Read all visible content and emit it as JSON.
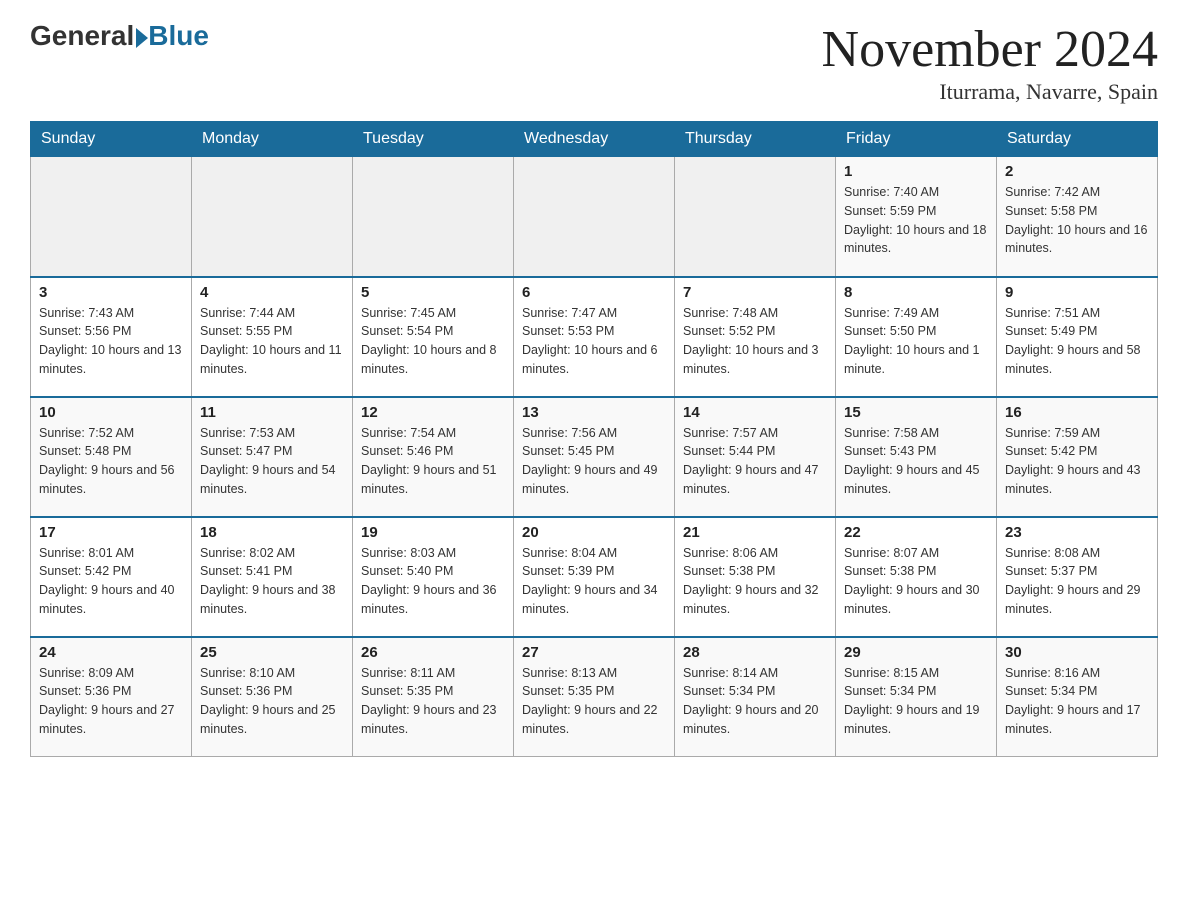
{
  "header": {
    "logo_general": "General",
    "logo_blue": "Blue",
    "month_title": "November 2024",
    "location": "Iturrama, Navarre, Spain"
  },
  "weekdays": [
    "Sunday",
    "Monday",
    "Tuesday",
    "Wednesday",
    "Thursday",
    "Friday",
    "Saturday"
  ],
  "weeks": [
    [
      {
        "day": "",
        "sunrise": "",
        "sunset": "",
        "daylight": "",
        "empty": true
      },
      {
        "day": "",
        "sunrise": "",
        "sunset": "",
        "daylight": "",
        "empty": true
      },
      {
        "day": "",
        "sunrise": "",
        "sunset": "",
        "daylight": "",
        "empty": true
      },
      {
        "day": "",
        "sunrise": "",
        "sunset": "",
        "daylight": "",
        "empty": true
      },
      {
        "day": "",
        "sunrise": "",
        "sunset": "",
        "daylight": "",
        "empty": true
      },
      {
        "day": "1",
        "sunrise": "Sunrise: 7:40 AM",
        "sunset": "Sunset: 5:59 PM",
        "daylight": "Daylight: 10 hours and 18 minutes.",
        "empty": false
      },
      {
        "day": "2",
        "sunrise": "Sunrise: 7:42 AM",
        "sunset": "Sunset: 5:58 PM",
        "daylight": "Daylight: 10 hours and 16 minutes.",
        "empty": false
      }
    ],
    [
      {
        "day": "3",
        "sunrise": "Sunrise: 7:43 AM",
        "sunset": "Sunset: 5:56 PM",
        "daylight": "Daylight: 10 hours and 13 minutes.",
        "empty": false
      },
      {
        "day": "4",
        "sunrise": "Sunrise: 7:44 AM",
        "sunset": "Sunset: 5:55 PM",
        "daylight": "Daylight: 10 hours and 11 minutes.",
        "empty": false
      },
      {
        "day": "5",
        "sunrise": "Sunrise: 7:45 AM",
        "sunset": "Sunset: 5:54 PM",
        "daylight": "Daylight: 10 hours and 8 minutes.",
        "empty": false
      },
      {
        "day": "6",
        "sunrise": "Sunrise: 7:47 AM",
        "sunset": "Sunset: 5:53 PM",
        "daylight": "Daylight: 10 hours and 6 minutes.",
        "empty": false
      },
      {
        "day": "7",
        "sunrise": "Sunrise: 7:48 AM",
        "sunset": "Sunset: 5:52 PM",
        "daylight": "Daylight: 10 hours and 3 minutes.",
        "empty": false
      },
      {
        "day": "8",
        "sunrise": "Sunrise: 7:49 AM",
        "sunset": "Sunset: 5:50 PM",
        "daylight": "Daylight: 10 hours and 1 minute.",
        "empty": false
      },
      {
        "day": "9",
        "sunrise": "Sunrise: 7:51 AM",
        "sunset": "Sunset: 5:49 PM",
        "daylight": "Daylight: 9 hours and 58 minutes.",
        "empty": false
      }
    ],
    [
      {
        "day": "10",
        "sunrise": "Sunrise: 7:52 AM",
        "sunset": "Sunset: 5:48 PM",
        "daylight": "Daylight: 9 hours and 56 minutes.",
        "empty": false
      },
      {
        "day": "11",
        "sunrise": "Sunrise: 7:53 AM",
        "sunset": "Sunset: 5:47 PM",
        "daylight": "Daylight: 9 hours and 54 minutes.",
        "empty": false
      },
      {
        "day": "12",
        "sunrise": "Sunrise: 7:54 AM",
        "sunset": "Sunset: 5:46 PM",
        "daylight": "Daylight: 9 hours and 51 minutes.",
        "empty": false
      },
      {
        "day": "13",
        "sunrise": "Sunrise: 7:56 AM",
        "sunset": "Sunset: 5:45 PM",
        "daylight": "Daylight: 9 hours and 49 minutes.",
        "empty": false
      },
      {
        "day": "14",
        "sunrise": "Sunrise: 7:57 AM",
        "sunset": "Sunset: 5:44 PM",
        "daylight": "Daylight: 9 hours and 47 minutes.",
        "empty": false
      },
      {
        "day": "15",
        "sunrise": "Sunrise: 7:58 AM",
        "sunset": "Sunset: 5:43 PM",
        "daylight": "Daylight: 9 hours and 45 minutes.",
        "empty": false
      },
      {
        "day": "16",
        "sunrise": "Sunrise: 7:59 AM",
        "sunset": "Sunset: 5:42 PM",
        "daylight": "Daylight: 9 hours and 43 minutes.",
        "empty": false
      }
    ],
    [
      {
        "day": "17",
        "sunrise": "Sunrise: 8:01 AM",
        "sunset": "Sunset: 5:42 PM",
        "daylight": "Daylight: 9 hours and 40 minutes.",
        "empty": false
      },
      {
        "day": "18",
        "sunrise": "Sunrise: 8:02 AM",
        "sunset": "Sunset: 5:41 PM",
        "daylight": "Daylight: 9 hours and 38 minutes.",
        "empty": false
      },
      {
        "day": "19",
        "sunrise": "Sunrise: 8:03 AM",
        "sunset": "Sunset: 5:40 PM",
        "daylight": "Daylight: 9 hours and 36 minutes.",
        "empty": false
      },
      {
        "day": "20",
        "sunrise": "Sunrise: 8:04 AM",
        "sunset": "Sunset: 5:39 PM",
        "daylight": "Daylight: 9 hours and 34 minutes.",
        "empty": false
      },
      {
        "day": "21",
        "sunrise": "Sunrise: 8:06 AM",
        "sunset": "Sunset: 5:38 PM",
        "daylight": "Daylight: 9 hours and 32 minutes.",
        "empty": false
      },
      {
        "day": "22",
        "sunrise": "Sunrise: 8:07 AM",
        "sunset": "Sunset: 5:38 PM",
        "daylight": "Daylight: 9 hours and 30 minutes.",
        "empty": false
      },
      {
        "day": "23",
        "sunrise": "Sunrise: 8:08 AM",
        "sunset": "Sunset: 5:37 PM",
        "daylight": "Daylight: 9 hours and 29 minutes.",
        "empty": false
      }
    ],
    [
      {
        "day": "24",
        "sunrise": "Sunrise: 8:09 AM",
        "sunset": "Sunset: 5:36 PM",
        "daylight": "Daylight: 9 hours and 27 minutes.",
        "empty": false
      },
      {
        "day": "25",
        "sunrise": "Sunrise: 8:10 AM",
        "sunset": "Sunset: 5:36 PM",
        "daylight": "Daylight: 9 hours and 25 minutes.",
        "empty": false
      },
      {
        "day": "26",
        "sunrise": "Sunrise: 8:11 AM",
        "sunset": "Sunset: 5:35 PM",
        "daylight": "Daylight: 9 hours and 23 minutes.",
        "empty": false
      },
      {
        "day": "27",
        "sunrise": "Sunrise: 8:13 AM",
        "sunset": "Sunset: 5:35 PM",
        "daylight": "Daylight: 9 hours and 22 minutes.",
        "empty": false
      },
      {
        "day": "28",
        "sunrise": "Sunrise: 8:14 AM",
        "sunset": "Sunset: 5:34 PM",
        "daylight": "Daylight: 9 hours and 20 minutes.",
        "empty": false
      },
      {
        "day": "29",
        "sunrise": "Sunrise: 8:15 AM",
        "sunset": "Sunset: 5:34 PM",
        "daylight": "Daylight: 9 hours and 19 minutes.",
        "empty": false
      },
      {
        "day": "30",
        "sunrise": "Sunrise: 8:16 AM",
        "sunset": "Sunset: 5:34 PM",
        "daylight": "Daylight: 9 hours and 17 minutes.",
        "empty": false
      }
    ]
  ]
}
